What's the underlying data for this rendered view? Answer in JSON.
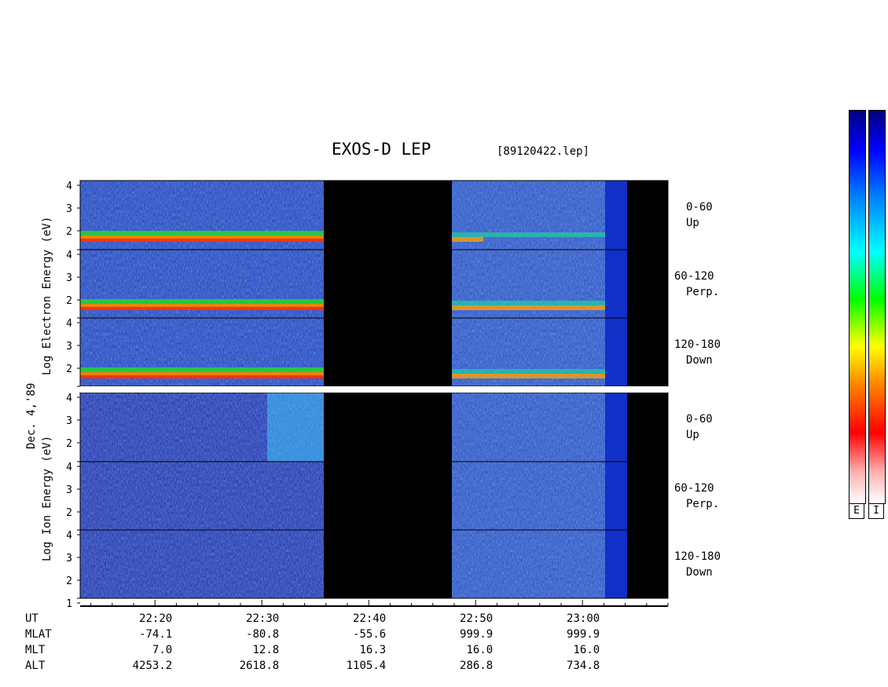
{
  "title": "EXOS-D LEP",
  "file": "[89120422.lep]",
  "date_label": "Dec. 4,'89",
  "electron_label": "Log   Electron   Energy  (eV)",
  "ion_label": "Log    Ion    Energy  (eV)",
  "colorbar_labels": [
    "E",
    "I"
  ],
  "chart_data": {
    "type": "heatmap",
    "x_axis": {
      "range": [
        "22:13",
        "23:08"
      ],
      "tick_labels": [
        "22:20",
        "22:30",
        "22:40",
        "22:50",
        "23:00"
      ]
    },
    "y_ticks": [
      "4",
      "3",
      "2"
    ],
    "panels": [
      {
        "species": "Electron",
        "pitch": "0-60",
        "dir": "Up",
        "ticks": [
          "4",
          "3",
          "2"
        ]
      },
      {
        "species": "Electron",
        "pitch": "60-120",
        "dir": "Perp.",
        "ticks": [
          "4",
          "3",
          "2"
        ]
      },
      {
        "species": "Electron",
        "pitch": "120-180",
        "dir": "Down",
        "ticks": [
          "4",
          "3",
          "2"
        ]
      },
      {
        "species": "Ion",
        "pitch": "0-60",
        "dir": "Up",
        "ticks": [
          "4",
          "3",
          "2"
        ]
      },
      {
        "species": "Ion",
        "pitch": "60-120",
        "dir": "Perp.",
        "ticks": [
          "4",
          "3",
          "2"
        ]
      },
      {
        "species": "Ion",
        "pitch": "120-180",
        "dir": "Down",
        "ticks": [
          "4",
          "3",
          "2",
          "1"
        ]
      }
    ],
    "data_gap": [
      "22:36",
      "22:46"
    ],
    "orbit_rows": [
      {
        "label": "UT",
        "values": [
          "22:20",
          "22:30",
          "22:40",
          "22:50",
          "23:00"
        ]
      },
      {
        "label": "MLAT",
        "values": [
          "-74.1",
          "-80.8",
          "-55.6",
          "999.9",
          "999.9"
        ]
      },
      {
        "label": "MLT",
        "values": [
          "7.0",
          "12.8",
          "16.3",
          "16.0",
          "16.0"
        ]
      },
      {
        "label": "ALT",
        "values": [
          "4253.2",
          "2618.8",
          "1105.4",
          "286.8",
          "734.8"
        ]
      }
    ]
  }
}
